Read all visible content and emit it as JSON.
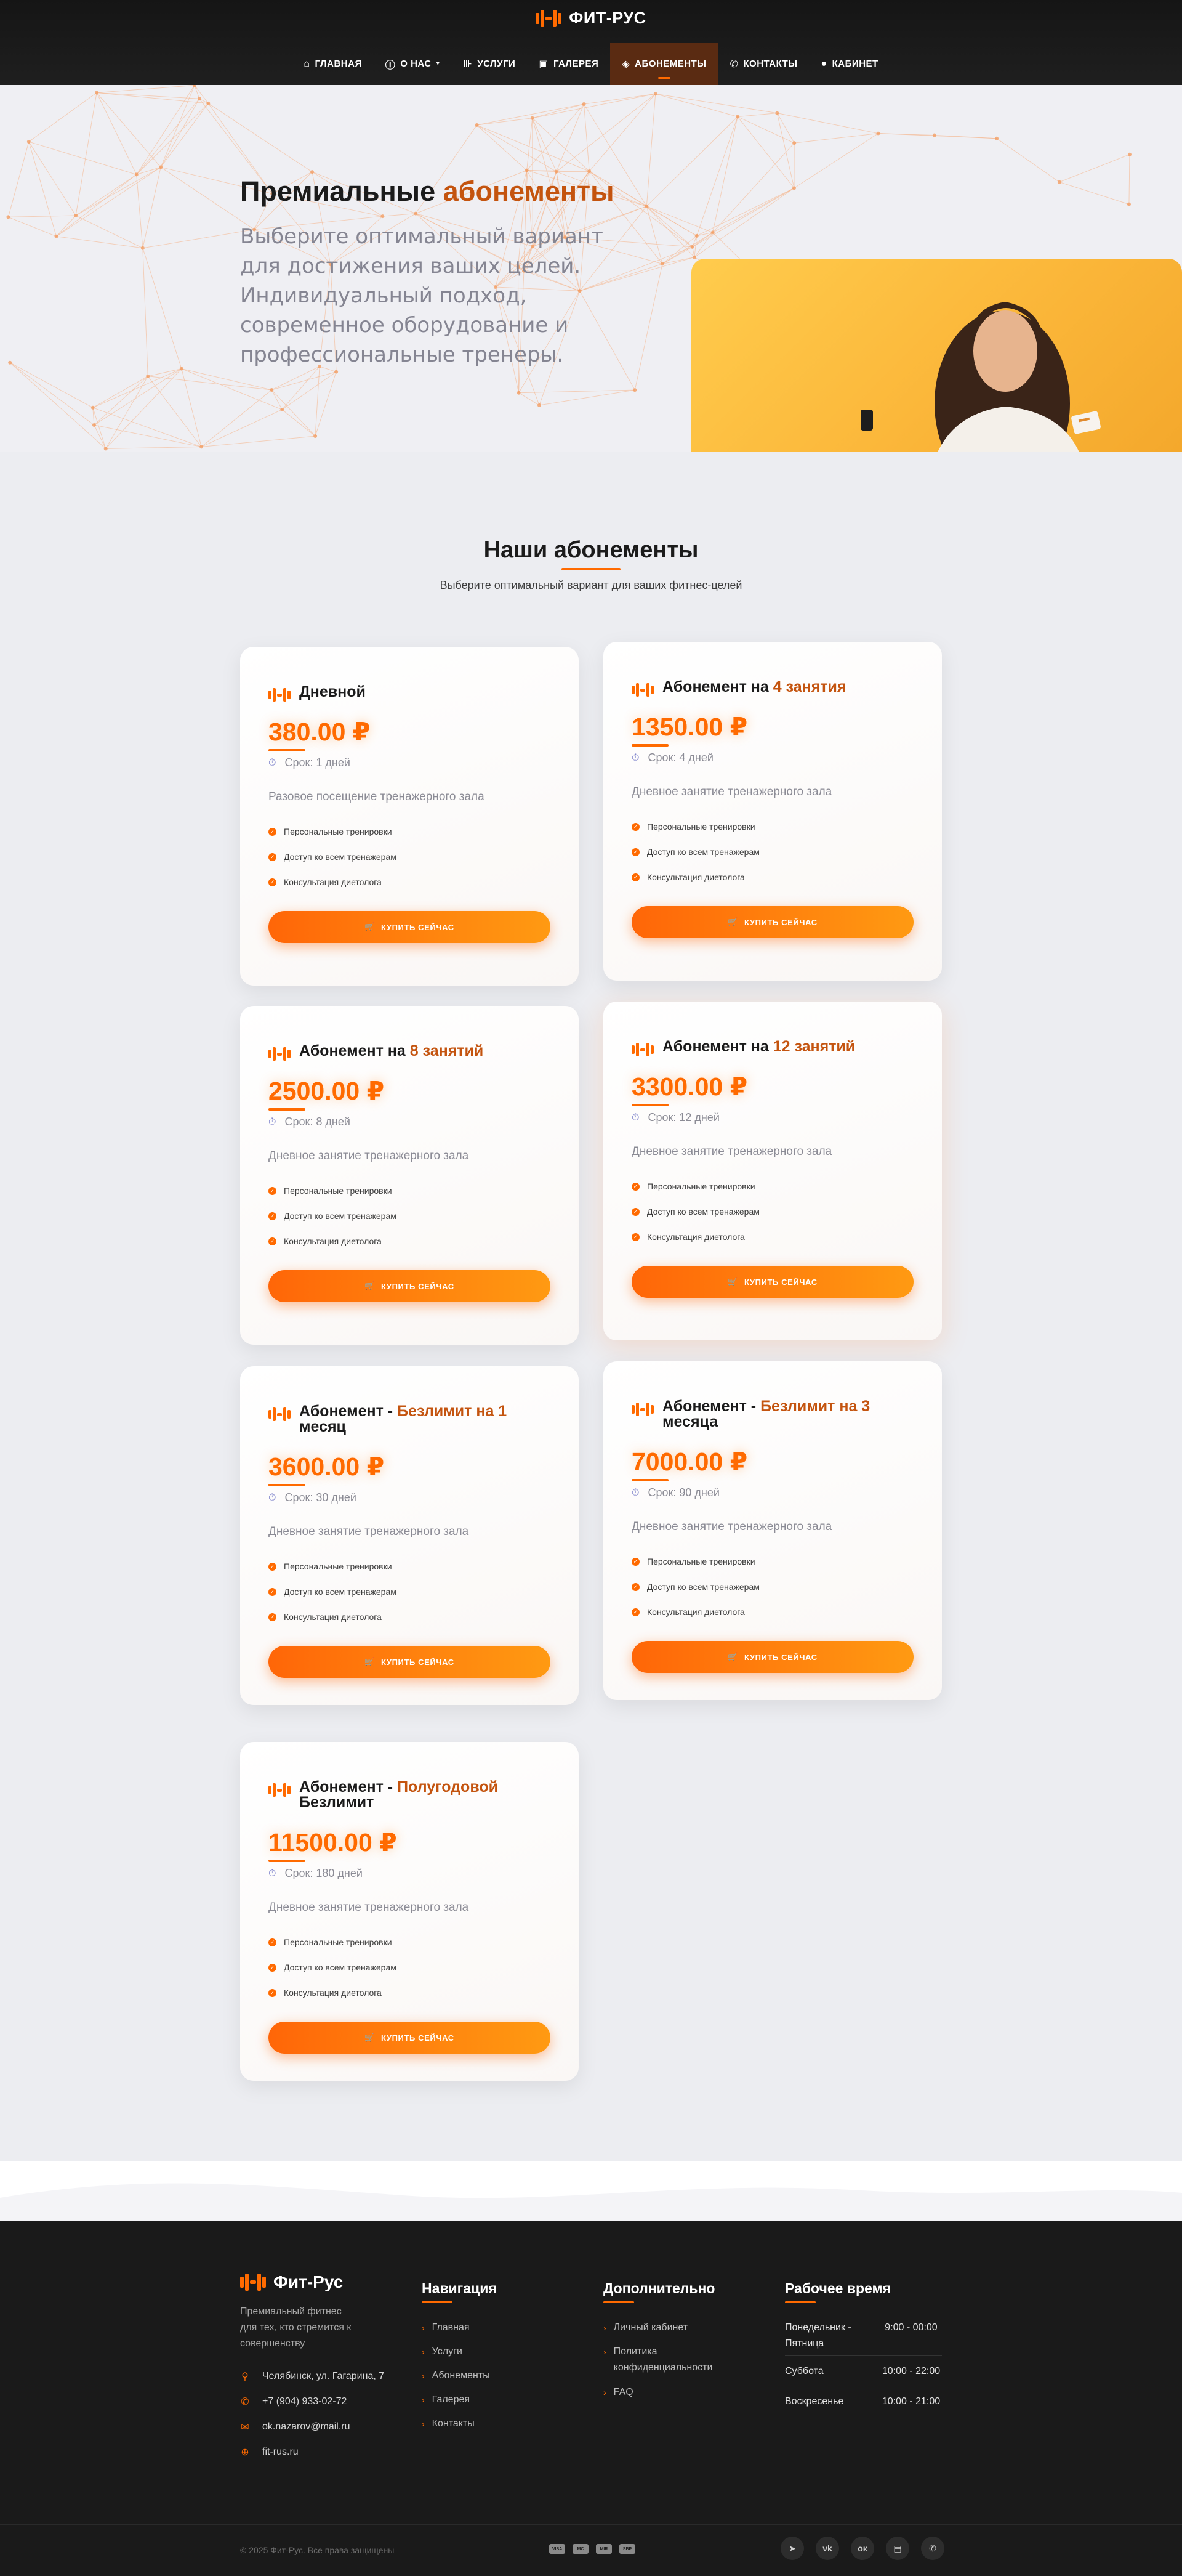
{
  "brand": {
    "name": "ФИТ-РУС",
    "accent": "#ff6a00",
    "dark": "#1a1a1a"
  },
  "nav": [
    {
      "label": "ГЛАВНАЯ",
      "icon": "home-icon",
      "glyph": "⌂"
    },
    {
      "label": "О НАС",
      "icon": "info-icon",
      "glyph": "ⓘ",
      "dropdown": true
    },
    {
      "label": "УСЛУГИ",
      "icon": "dumbbell-icon",
      "glyph": "⊪"
    },
    {
      "label": "ГАЛЕРЕЯ",
      "icon": "images-icon",
      "glyph": "▣"
    },
    {
      "label": "АБОНЕМЕНТЫ",
      "icon": "tags-icon",
      "glyph": "◈",
      "active": true
    },
    {
      "label": "КОНТАКТЫ",
      "icon": "phone-icon",
      "glyph": "✆"
    },
    {
      "label": "КАБИНЕТ",
      "icon": "user-icon",
      "glyph": "●"
    }
  ],
  "hero": {
    "title": "Премиальные ",
    "title_accent": "абонементы",
    "text": "Выберите оптимальный вариант для достижения ваших целей. Индивидуальный подход, современное оборудование и профессиональные тренеры."
  },
  "section": {
    "title": "Наши абонементы",
    "subtitle": "Выберите оптимальный вариант для ваших фитнес-целей"
  },
  "plans": [
    {
      "title": "Дневной",
      "title_accent": "",
      "price": "380.00 ₽",
      "term": "Срок: 1 дней",
      "desc": "Разовое посещение тренажерного зала"
    },
    {
      "title": "Абонемент на ",
      "title_accent": "4 занятия",
      "price": "1350.00 ₽",
      "term": "Срок: 4 дней",
      "desc": "Дневное занятие тренажерного зала"
    },
    {
      "title": "Абонемент на ",
      "title_accent": "8 занятий",
      "price": "2500.00 ₽",
      "term": "Срок: 8 дней",
      "desc": "Дневное занятие тренажерного зала"
    },
    {
      "title": "Абонемент на ",
      "title_accent": "12 занятий",
      "price": "3300.00 ₽",
      "term": "Срок: 12 дней",
      "desc": "Дневное занятие тренажерного зала"
    },
    {
      "title": "Абонемент - ",
      "title_accent": "Безлимит на 1",
      "title_tail": "месяц",
      "price": "3600.00 ₽",
      "term": "Срок: 30 дней",
      "desc": "Дневное занятие тренажерного зала"
    },
    {
      "title": "Абонемент - ",
      "title_accent": "Безлимит на 3",
      "title_tail": "месяца",
      "price": "7000.00 ₽",
      "term": "Срок: 90 дней",
      "desc": "Дневное занятие тренажерного зала"
    },
    {
      "title": "Абонемент - ",
      "title_accent": "Полугодовой",
      "title_tail": "Безлимит",
      "price": "11500.00 ₽",
      "term": "Срок: 180 дней",
      "desc": "Дневное занятие тренажерного зала"
    }
  ],
  "features": [
    "Персональные тренировки",
    "Доступ ко всем тренажерам",
    "Консультация диетолога"
  ],
  "buy_label": "КУПИТЬ СЕЙЧАС",
  "footer": {
    "name": "Фит-Рус",
    "desc": "Премиальный фитнес для тех, кто стремится к совершенству",
    "contacts": [
      {
        "icon": "map-pin-icon",
        "glyph": "⚲",
        "text": "Челябинск, ул. Гагарина, 7"
      },
      {
        "icon": "phone-icon",
        "glyph": "✆",
        "text": "+7 (904) 933-02-72"
      },
      {
        "icon": "mail-icon",
        "glyph": "✉",
        "text": "ok.nazarov@mail.ru"
      },
      {
        "icon": "globe-icon",
        "glyph": "⊕",
        "text": "fit-rus.ru"
      }
    ],
    "nav_title": "Навигация",
    "nav_links": [
      "Главная",
      "Услуги",
      "Абонементы",
      "Галерея",
      "Контакты"
    ],
    "extra_title": "Дополнительно",
    "extra_links": [
      "Личный кабинет",
      "Политика конфиденциальности",
      "FAQ"
    ],
    "hours_title": "Рабочее время",
    "hours": [
      {
        "day": "Понедельник - Пятница",
        "time": "9:00 - 00:00"
      },
      {
        "day": "Суббота",
        "time": "10:00 - 22:00"
      },
      {
        "day": "Воскресенье",
        "time": "10:00 - 21:00"
      }
    ],
    "copyright": "© 2025 Фит-Рус. Все права защищены",
    "payments": [
      "VISA",
      "MC",
      "MIR",
      "SBP"
    ],
    "socials": [
      {
        "icon": "telegram-icon",
        "glyph": "➤"
      },
      {
        "icon": "vk-icon",
        "glyph": "vk"
      },
      {
        "icon": "odnoklassniki-icon",
        "glyph": "ок"
      },
      {
        "icon": "twitch-icon",
        "glyph": "▤"
      },
      {
        "icon": "whatsapp-icon",
        "glyph": "✆"
      }
    ]
  }
}
